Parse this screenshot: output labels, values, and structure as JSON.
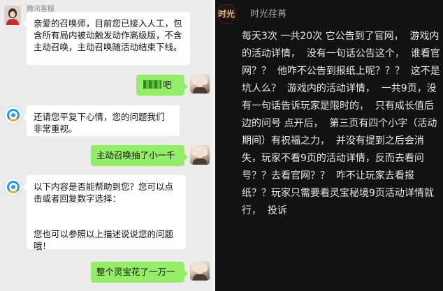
{
  "chat": {
    "agent_name": "腾讯客服",
    "messages": [
      {
        "from": "agent",
        "text": "亲爱的召唤师，目前您已接入人工，包含所有局内被动触发动作高级版，不含主动召唤，主动召唤随活动结束下线。"
      },
      {
        "from": "user",
        "text": "吧",
        "censored": true
      },
      {
        "from": "bot",
        "text": "还请您平复下心情，您的问题我们非常重视。"
      },
      {
        "from": "user",
        "text": "主动召唤抽了小一千"
      },
      {
        "from": "bot",
        "text": "以下内容是否能帮助到您？您可以点击或者回复数字选择：\n\n\n您也可以参照以上描述说说您的问题哦！"
      },
      {
        "from": "user",
        "text": "整个灵宝花了一万一"
      }
    ]
  },
  "post": {
    "avatar_text": "时光",
    "username": "时光荏苒",
    "body": "每天3次 一共20次 它公告到了官网，  游戏内的活动详情，  没有一句话公告这个，  谁看官网？？  他咋不公告到报纸上呢？？？  这不是坑人么？  游戏内的活动详情，  一共9页，没有一句话告诉玩家是限时的，  只有成长值后边的问号 点开后，  第三页有四个小字（活动期间）有祝福之力，  并没有提到之后会消失，玩家不看9页的活动详情，反而去看问号？？去看官网？？  咋不让玩家去看报纸？？玩家只需要看灵宝秘境9页活动详情就行，  投诉"
  }
}
